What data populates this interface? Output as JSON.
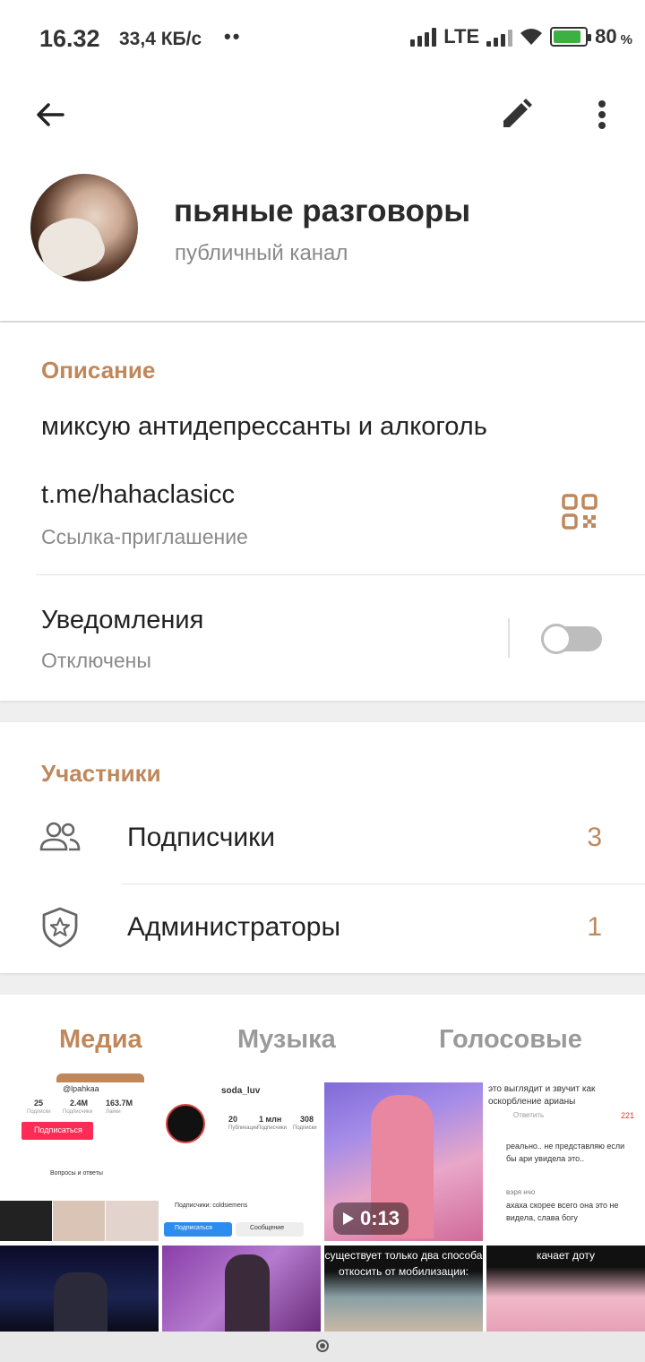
{
  "status_bar": {
    "time": "16.32",
    "speed": "33,4 КБ/с",
    "dots": "••",
    "network": "LTE",
    "battery": "80",
    "battery_pct_sign": "%"
  },
  "channel": {
    "name": "пьяные разговоры",
    "type": "публичный канал"
  },
  "info": {
    "description_title": "Описание",
    "description": "миксую антидепрессанты и алкоголь",
    "link": "t.me/hahaclasicc",
    "link_subtitle": "Ссылка-приглашение",
    "notifications_label": "Уведомления",
    "notifications_state": "Отключены",
    "notifications_enabled": false
  },
  "members": {
    "title": "Участники",
    "rows": [
      {
        "label": "Подписчики",
        "count": "3",
        "icon": "people-icon"
      },
      {
        "label": "Администраторы",
        "count": "1",
        "icon": "shield-star-icon"
      }
    ]
  },
  "tabs": [
    {
      "label": "Медиа",
      "active": true
    },
    {
      "label": "Музыка",
      "active": false
    },
    {
      "label": "Голосовые",
      "active": false
    }
  ],
  "media": {
    "video_duration": "0:13",
    "thumb1": {
      "handle": "@lpahkaa",
      "stats": [
        "25",
        "2.4M",
        "163.7M"
      ],
      "stat_labels": [
        "Подписки",
        "Подписчики",
        "Лайки"
      ],
      "button": "Подписаться",
      "bio": "Вопросы и ответы"
    },
    "thumb2": {
      "handle": "soda_luv",
      "stats": [
        "20",
        "1 млн",
        "308"
      ],
      "stat_labels": [
        "Публикации",
        "Подписчики",
        "Подписки"
      ],
      "follow": "Подписаться",
      "message": "Сообщение",
      "followers_note": "Подписчики: coldsiemens"
    },
    "thumb4": {
      "lines": [
        "это выглядит и звучит как",
        "оскорбление арианы",
        "реально.. не представляю если",
        "бы ари увидела это..",
        "вэря нчо",
        "ахаха скорее всего она это не",
        "видела, слава богу"
      ],
      "likes": "221",
      "reply": "Ответить"
    },
    "thumb7_caption": "существует только два способа откосить от мобилизации:",
    "thumb8_caption": "качает доту"
  },
  "colors": {
    "accent": "#c0875a",
    "muted": "#8a8a8a",
    "tab_inactive": "#9a9a9a"
  }
}
